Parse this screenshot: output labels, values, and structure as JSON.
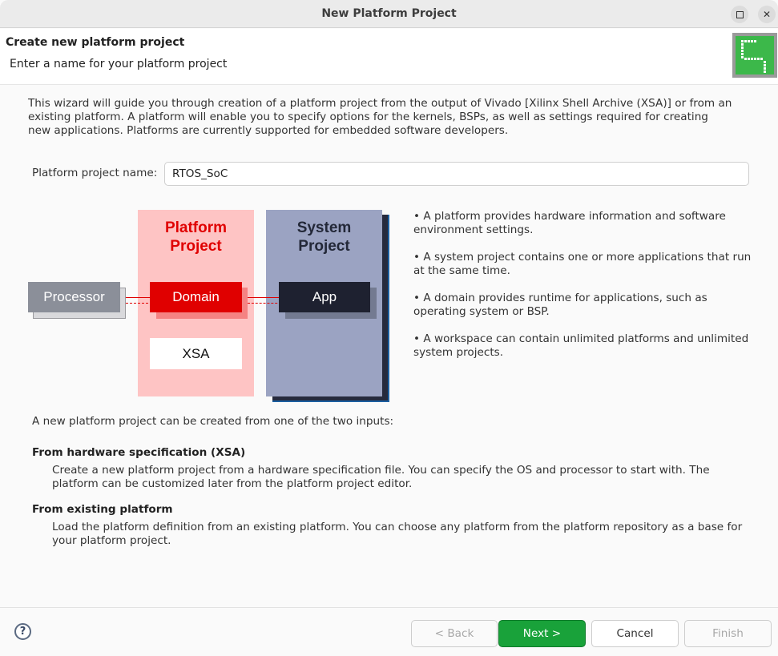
{
  "window": {
    "title": "New Platform Project",
    "controls": [
      "maximize",
      "close"
    ],
    "close_glyph": "✕"
  },
  "header": {
    "title": "Create new platform project",
    "subtitle": "Enter a name for your platform project",
    "logo_icon": "platform-wizard-icon"
  },
  "intro": "This wizard will guide you through creation of a platform project from the output of Vivado [Xilinx Shell Archive (XSA)] or from an existing platform. A platform will enable you to specify options for the kernels, BSPs, as well as settings required for creating new applications. Platforms are currently supported for embedded software developers.",
  "form": {
    "name_label": "Platform project name:",
    "name_value": "RTOS_SoC"
  },
  "diagram": {
    "platform_title_line1": "Platform",
    "platform_title_line2": "Project",
    "system_title_line1": "System",
    "system_title_line2": "Project",
    "processor": "Processor",
    "domain": "Domain",
    "app": "App",
    "xsa": "XSA",
    "colors": {
      "platform_bg": "#fec4c4",
      "platform_accent": "#e00000",
      "system_bg": "#9ba3c2",
      "system_dark": "#1e2130",
      "processor": "#8b8f99"
    }
  },
  "bullets": [
    "• A platform provides hardware information and software environment settings.",
    "• A system project contains one or more applications that run at the same time.",
    "• A domain provides runtime for applications, such as operating system or BSP.",
    "• A workspace can contain unlimited platforms and unlimited system projects."
  ],
  "options": {
    "intro": "A new platform project can be created from one of the two inputs:",
    "items": [
      {
        "title": "From hardware specification (XSA)",
        "desc": "Create a new platform project from a hardware specification file. You can specify the OS and processor to start with. The platform can be customized later from the platform project editor."
      },
      {
        "title": "From existing platform",
        "desc": "Load the platform definition from an existing platform. You can choose any platform from the platform repository as a base for your platform project."
      }
    ]
  },
  "footer": {
    "help_glyph": "?",
    "back": "< Back",
    "next": "Next >",
    "cancel": "Cancel",
    "finish": "Finish",
    "primary_color": "#19a23a"
  }
}
